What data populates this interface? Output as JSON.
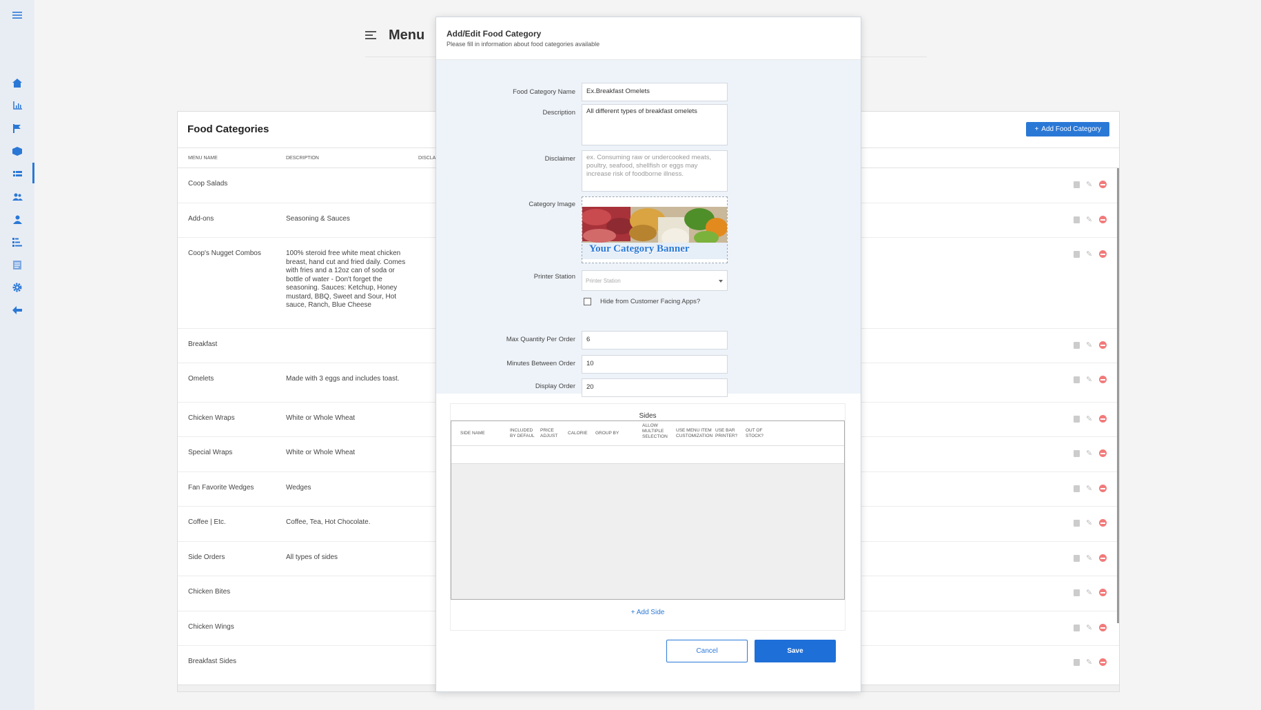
{
  "header": {
    "title": "Menu"
  },
  "sidebar": {
    "icons": [
      "menu-icon",
      "home-icon",
      "chart-icon",
      "flag-icon",
      "box-icon",
      "list-icon",
      "users-icon",
      "person-icon",
      "sort-icon",
      "document-icon",
      "gear-icon",
      "back-arrow-icon"
    ]
  },
  "categories": {
    "title": "Food Categories",
    "add_button": "Add Food Category",
    "columns": [
      "MENU NAME",
      "DESCRIPTION",
      "DISCLA"
    ],
    "rows": [
      {
        "name": "Coop Salads",
        "description": ""
      },
      {
        "name": "Add-ons",
        "description": "Seasoning & Sauces"
      },
      {
        "name": "Coop's Nugget Combos",
        "description": "100% steroid free white meat chicken breast, hand cut and fried daily. Comes with fries and a 12oz can of soda or bottle of water - Don't forget the seasoning. Sauces: Ketchup, Honey mustard, BBQ, Sweet and Sour, Hot sauce, Ranch, Blue Cheese"
      },
      {
        "name": "Breakfast",
        "description": ""
      },
      {
        "name": "Omelets",
        "description": "Made with 3 eggs and includes toast."
      },
      {
        "name": "Chicken Wraps",
        "description": "White or Whole Wheat"
      },
      {
        "name": "Special Wraps",
        "description": "White or Whole Wheat"
      },
      {
        "name": "Fan Favorite Wedges",
        "description": "Wedges"
      },
      {
        "name": "Coffee | Etc.",
        "description": "Coffee, Tea, Hot Chocolate."
      },
      {
        "name": "Side Orders",
        "description": "All types of sides"
      },
      {
        "name": "Chicken Bites",
        "description": ""
      },
      {
        "name": "Chicken Wings",
        "description": ""
      },
      {
        "name": "Breakfast Sides",
        "description": ""
      }
    ]
  },
  "modal": {
    "title": "Add/Edit Food Category",
    "subtitle": "Please fill in information about food categories available",
    "fields": {
      "name_label": "Food Category Name",
      "name_value": "Ex.Breakfast Omelets",
      "description_label": "Description",
      "description_value": "All different types of breakfast omelets",
      "disclaimer_label": "Disclaimer",
      "disclaimer_placeholder": "ex. Consuming raw or undercooked meats, poultry, seafood, shellfish or eggs may increase risk of foodborne illness.",
      "image_label": "Category Image",
      "banner_text": "Your Category Banner",
      "printer_label": "Printer Station",
      "printer_placeholder": "Printer Station",
      "hide_label": "Hide from Customer Facing Apps?",
      "hide_checked": false,
      "max_qty_label": "Max Quantity Per Order",
      "max_qty_value": "6",
      "minutes_label": "Minutes Between Order",
      "minutes_value": "10",
      "display_label": "Display Order",
      "display_value": "20"
    },
    "sides": {
      "title": "Sides",
      "columns": [
        "SIDE NAME",
        "INCLUDED BY DEFAUL",
        "PRICE ADJUST",
        "CALORIE",
        "GROUP BY",
        "ALLOW MULTIPLE SELECTION",
        "USE MENU ITEM CUSTOMIZATION",
        "USE BAR PRINTER?",
        "OUT OF STOCK?"
      ],
      "add_label": "Add Side"
    },
    "cancel_label": "Cancel",
    "save_label": "Save"
  },
  "colors": {
    "accent": "#2a78d6",
    "delete": "#f27a7a",
    "modal_body": "#eef3f9"
  }
}
